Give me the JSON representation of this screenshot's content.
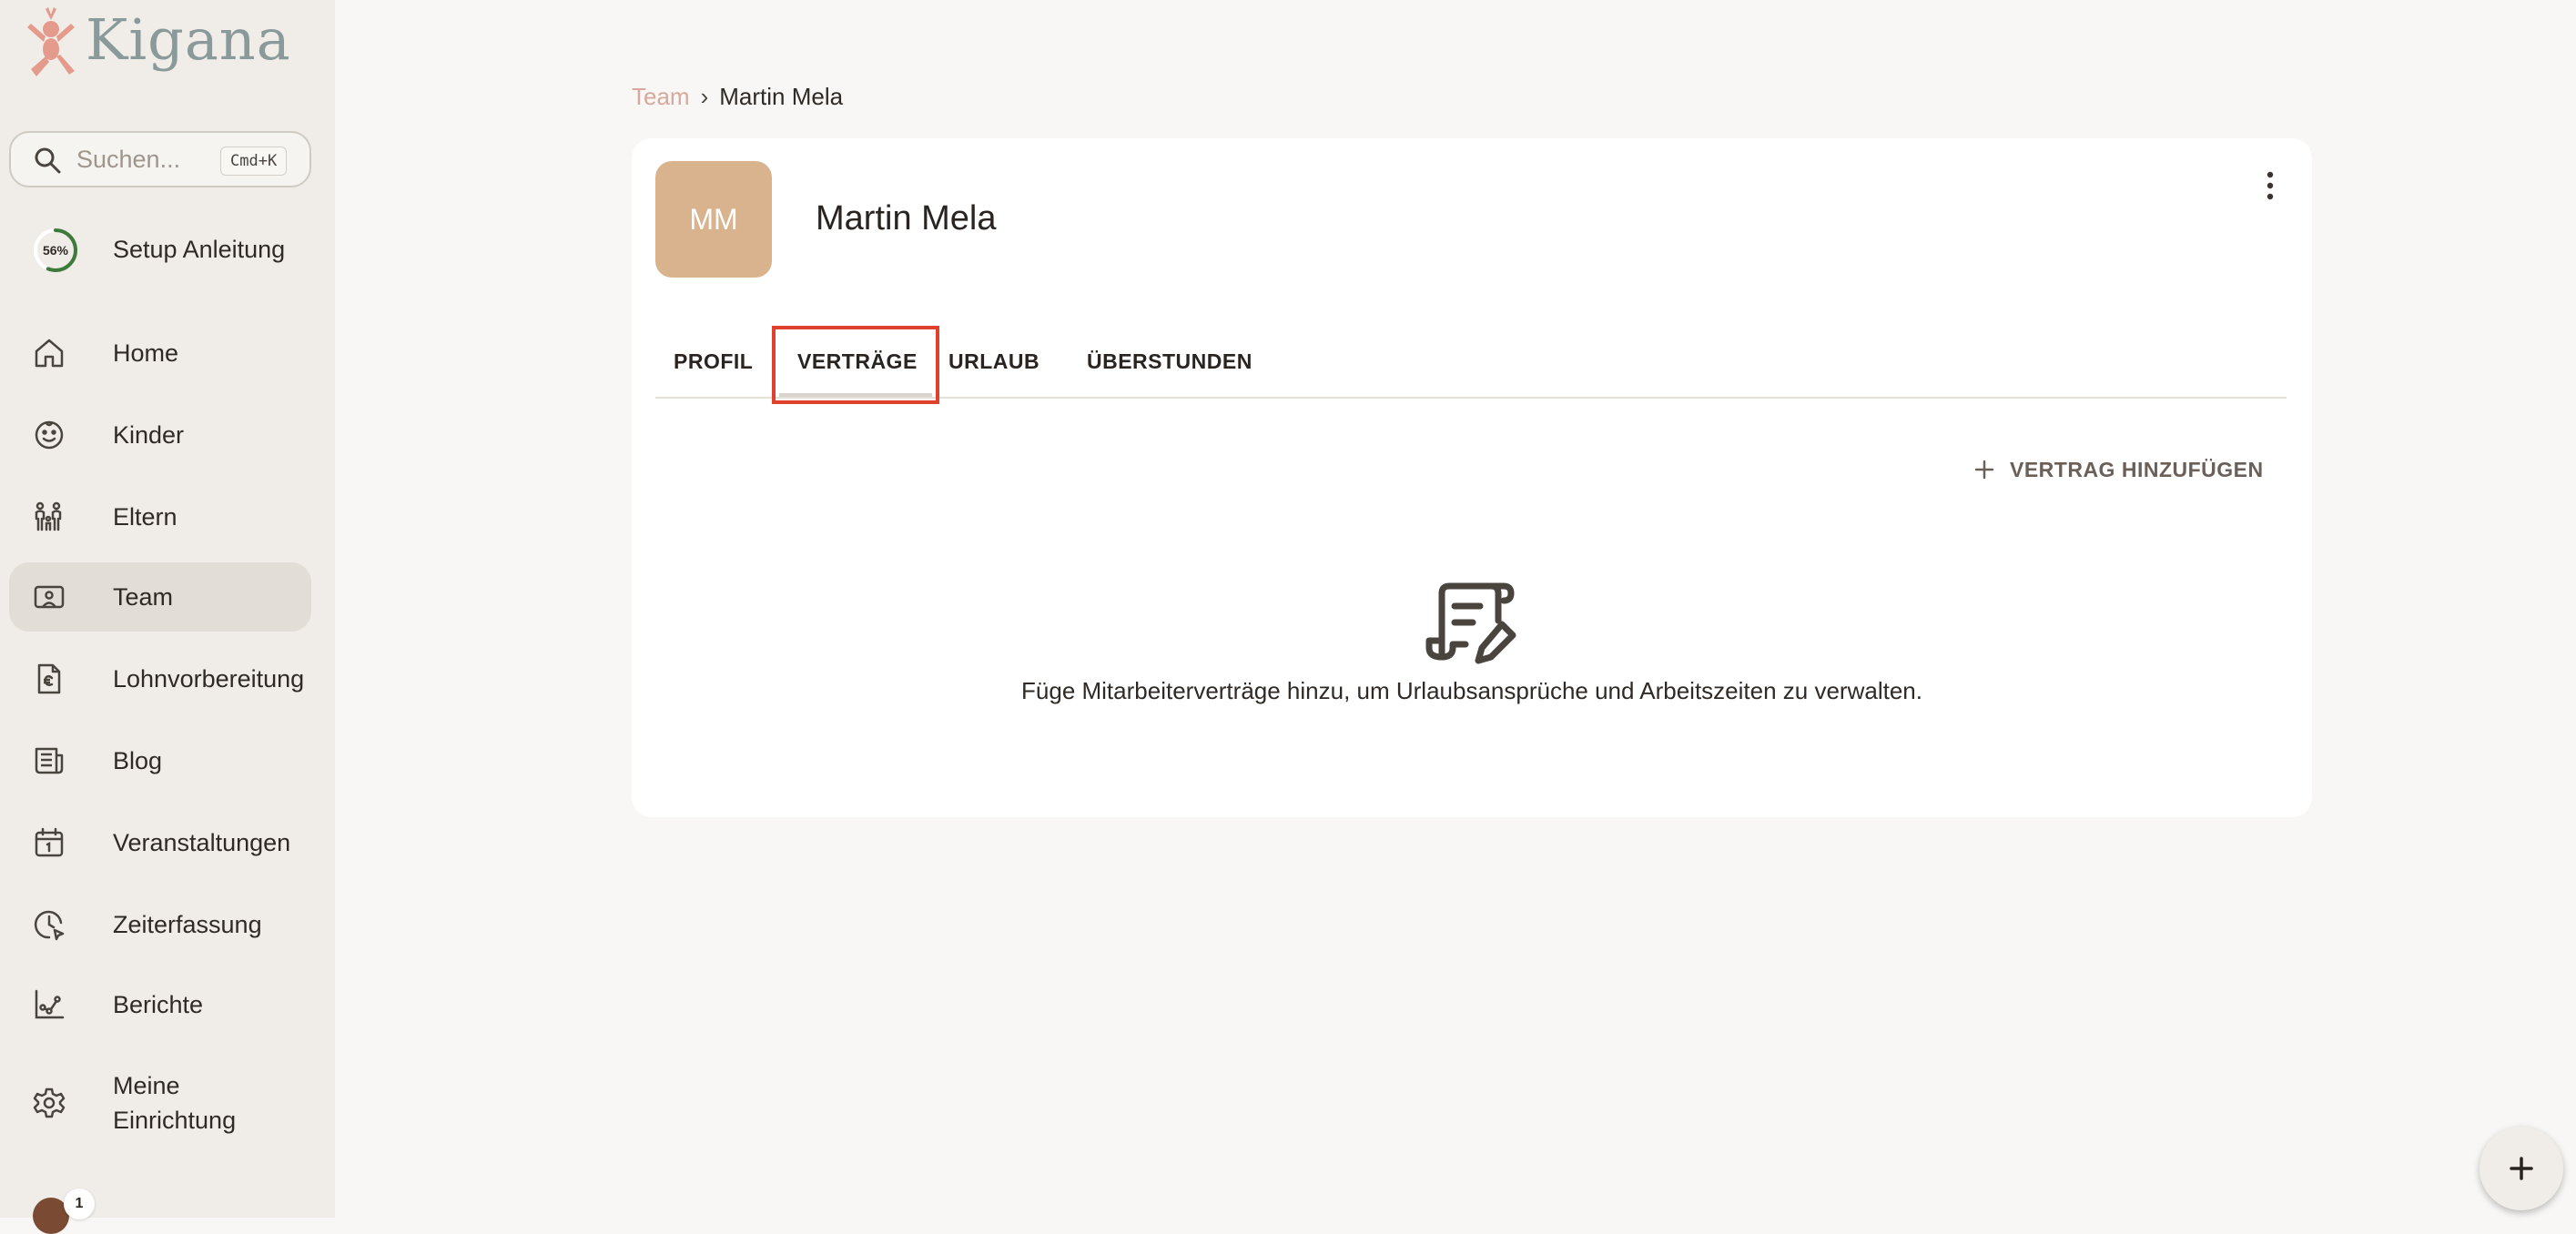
{
  "app": {
    "logo_text": "Kigana"
  },
  "search": {
    "placeholder": "Suchen...",
    "shortcut": "Cmd+K"
  },
  "setup": {
    "label": "Setup Anleitung",
    "progress_text": "56%",
    "progress": 0.56
  },
  "sidebar": {
    "items": [
      {
        "label": "Home",
        "icon": "home-icon"
      },
      {
        "label": "Kinder",
        "icon": "smiley-icon"
      },
      {
        "label": "Eltern",
        "icon": "family-icon"
      },
      {
        "label": "Team",
        "icon": "team-icon",
        "active": true
      },
      {
        "label": "Lohnvorbereitung",
        "icon": "payroll-icon"
      },
      {
        "label": "Blog",
        "icon": "blog-icon"
      },
      {
        "label": "Veranstaltungen",
        "icon": "calendar-icon"
      },
      {
        "label": "Zeiterfassung",
        "icon": "clock-icon"
      },
      {
        "label": "Berichte",
        "icon": "chart-icon"
      },
      {
        "label_line1": "Meine",
        "label_line2": "Einrichtung",
        "icon": "gear-icon"
      }
    ],
    "notification_count": "1"
  },
  "breadcrumb": {
    "parent": "Team",
    "separator": "›",
    "current": "Martin Mela"
  },
  "profile": {
    "initials": "MM",
    "name": "Martin Mela"
  },
  "tabs": [
    {
      "label": "PROFIL"
    },
    {
      "label": "VERTRÄGE",
      "active": true
    },
    {
      "label": "URLAUB"
    },
    {
      "label": "ÜBERSTUNDEN"
    }
  ],
  "contracts": {
    "add_label": "VERTRAG HINZUFÜGEN",
    "empty_text": "Füge Mitarbeiterverträge hinzu, um Urlaubsansprüche und Arbeitszeiten zu verwalten."
  },
  "colors": {
    "accent": "#e0412d",
    "avatar_bg": "#d8b38e",
    "sidebar_bg": "#f0ede8",
    "progress": "#3e7a3a"
  }
}
